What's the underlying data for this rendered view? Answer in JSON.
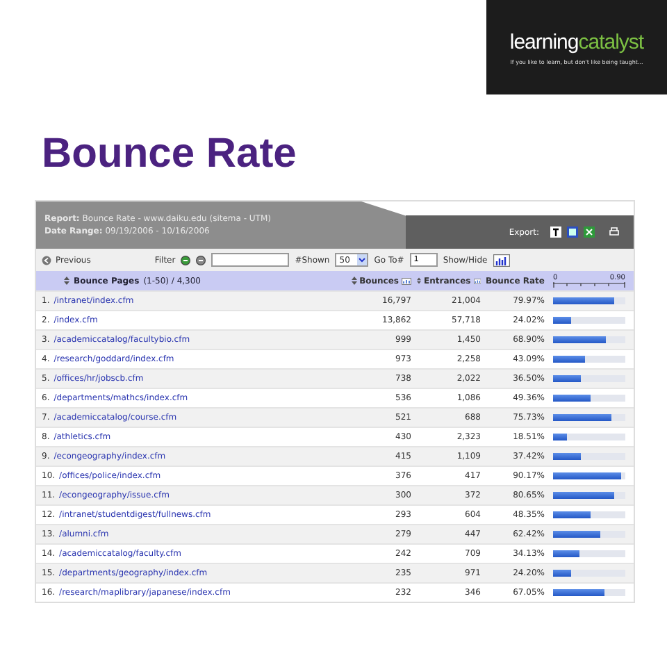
{
  "logo": {
    "word_1": "learning",
    "word_2": "catalyst",
    "tagline": "If you like to learn, but don't like being taught..."
  },
  "title": "Bounce Rate",
  "report": {
    "report_label": "Report:",
    "report_value": "Bounce Rate - www.daiku.edu (sitema - UTM)",
    "date_label": "Date Range:",
    "date_value": "09/19/2006 - 10/16/2006",
    "export_label": "Export:"
  },
  "toolbar": {
    "previous": "Previous",
    "filter_label": "Filter",
    "shown_label": "#Shown",
    "shown_value": "50",
    "goto_label": "Go To#",
    "goto_value": "1",
    "showhide_label": "Show/Hide"
  },
  "columns": {
    "pages": "Bounce Pages",
    "range": "(1-50) / 4,300",
    "bounces": "Bounces",
    "entrances": "Entrances",
    "rate": "Bounce Rate",
    "scale_min": "0",
    "scale_max": "0.90"
  },
  "rows": [
    {
      "index": "1.",
      "page": "/intranet/index.cfm",
      "bounces": "16,797",
      "entrances": "21,004",
      "rate": "79.97%",
      "level": 0.84
    },
    {
      "index": "2.",
      "page": "/index.cfm",
      "bounces": "13,862",
      "entrances": "57,718",
      "rate": "24.02%",
      "level": 0.25
    },
    {
      "index": "3.",
      "page": "/academiccatalog/facultybio.cfm",
      "bounces": "999",
      "entrances": "1,450",
      "rate": "68.90%",
      "level": 0.73
    },
    {
      "index": "4.",
      "page": "/research/goddard/index.cfm",
      "bounces": "973",
      "entrances": "2,258",
      "rate": "43.09%",
      "level": 0.45
    },
    {
      "index": "5.",
      "page": "/offices/hr/jobscb.cfm",
      "bounces": "738",
      "entrances": "2,022",
      "rate": "36.50%",
      "level": 0.38
    },
    {
      "index": "6.",
      "page": "/departments/mathcs/index.cfm",
      "bounces": "536",
      "entrances": "1,086",
      "rate": "49.36%",
      "level": 0.52
    },
    {
      "index": "7.",
      "page": "/academiccatalog/course.cfm",
      "bounces": "521",
      "entrances": "688",
      "rate": "75.73%",
      "level": 0.8
    },
    {
      "index": "8.",
      "page": "/athletics.cfm",
      "bounces": "430",
      "entrances": "2,323",
      "rate": "18.51%",
      "level": 0.19
    },
    {
      "index": "9.",
      "page": "/econgeography/index.cfm",
      "bounces": "415",
      "entrances": "1,109",
      "rate": "37.42%",
      "level": 0.39
    },
    {
      "index": "10.",
      "page": "/offices/police/index.cfm",
      "bounces": "376",
      "entrances": "417",
      "rate": "90.17%",
      "level": 0.95
    },
    {
      "index": "11.",
      "page": "/econgeography/issue.cfm",
      "bounces": "300",
      "entrances": "372",
      "rate": "80.65%",
      "level": 0.85
    },
    {
      "index": "12.",
      "page": "/intranet/studentdigest/fullnews.cfm",
      "bounces": "293",
      "entrances": "604",
      "rate": "48.35%",
      "level": 0.51
    },
    {
      "index": "13.",
      "page": "/alumni.cfm",
      "bounces": "279",
      "entrances": "447",
      "rate": "62.42%",
      "level": 0.66
    },
    {
      "index": "14.",
      "page": "/academiccatalog/faculty.cfm",
      "bounces": "242",
      "entrances": "709",
      "rate": "34.13%",
      "level": 0.36
    },
    {
      "index": "15.",
      "page": "/departments/geography/index.cfm",
      "bounces": "235",
      "entrances": "971",
      "rate": "24.20%",
      "level": 0.25
    },
    {
      "index": "16.",
      "page": "/research/maplibrary/japanese/index.cfm",
      "bounces": "232",
      "entrances": "346",
      "rate": "67.05%",
      "level": 0.71
    }
  ]
}
